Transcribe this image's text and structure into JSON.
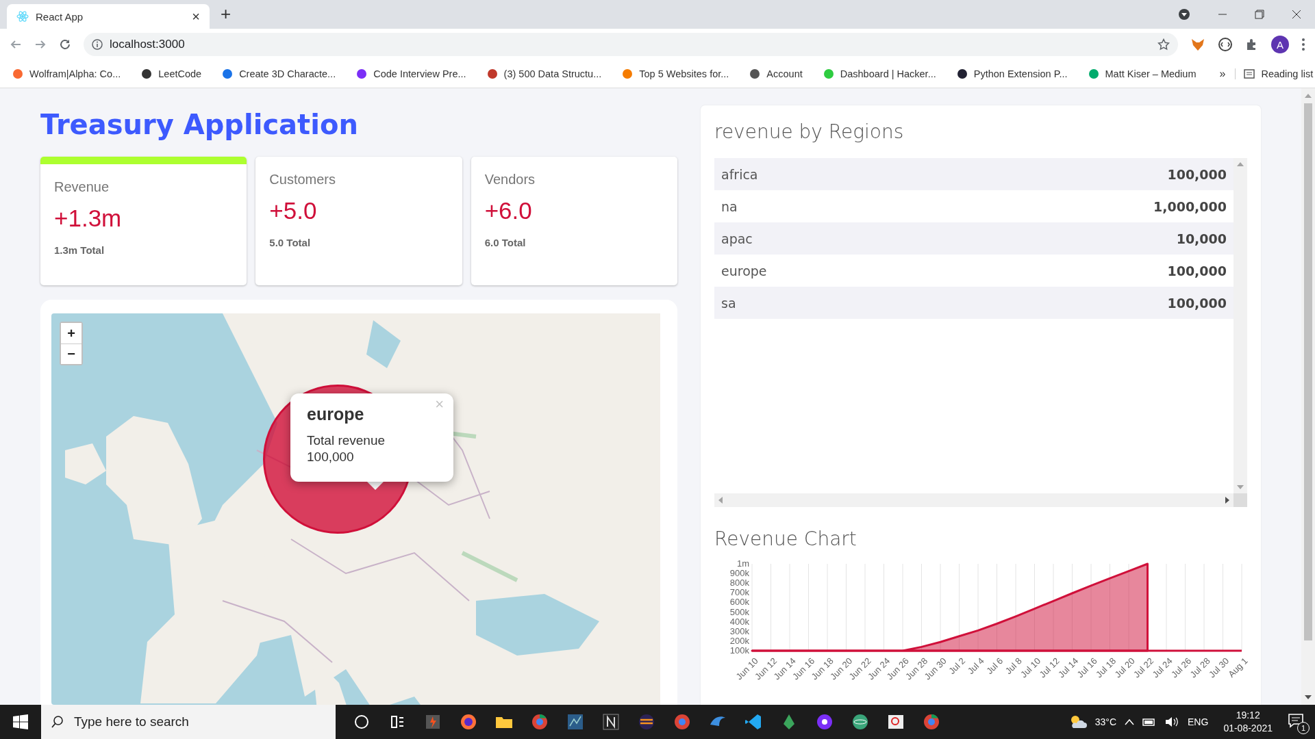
{
  "browser": {
    "tab": {
      "title": "React App",
      "close": "×"
    },
    "new_tab": "+",
    "url": "localhost:3000",
    "profile_initial": "A",
    "bookmarks": [
      {
        "label": "Wolfram|Alpha: Co..."
      },
      {
        "label": "LeetCode"
      },
      {
        "label": "Create 3D Characte..."
      },
      {
        "label": "Code Interview Pre..."
      },
      {
        "label": "(3) 500 Data Structu..."
      },
      {
        "label": "Top 5 Websites for..."
      },
      {
        "label": "Account"
      },
      {
        "label": "Dashboard | Hacker..."
      },
      {
        "label": "Python Extension P..."
      },
      {
        "label": "Matt Kiser – Medium"
      }
    ],
    "more": "»",
    "reading_list": "Reading list"
  },
  "app": {
    "title": "Treasury Application",
    "cards": [
      {
        "label": "Revenue",
        "value": "+1.3m",
        "total": "1.3m Total",
        "selected": true
      },
      {
        "label": "Customers",
        "value": "+5.0",
        "total": "5.0 Total",
        "selected": false
      },
      {
        "label": "Vendors",
        "value": "+6.0",
        "total": "6.0 Total",
        "selected": false
      }
    ]
  },
  "map": {
    "kind": "picture",
    "zoom_in": "+",
    "zoom_out": "−",
    "popup": {
      "title": "europe",
      "text": "Total revenue",
      "value": "100,000",
      "close": "×"
    }
  },
  "regions": {
    "title": "revenue by Regions",
    "rows": [
      {
        "region": "africa",
        "revenue": "100,000"
      },
      {
        "region": "na",
        "revenue": "1,000,000"
      },
      {
        "region": "apac",
        "revenue": "10,000"
      },
      {
        "region": "europe",
        "revenue": "100,000"
      },
      {
        "region": "sa",
        "revenue": "100,000"
      }
    ]
  },
  "chart": {
    "title": "Revenue Chart",
    "chart_data": {
      "type": "area",
      "categories": [
        "Jun 10",
        "Jun 12",
        "Jun 14",
        "Jun 16",
        "Jun 18",
        "Jun 20",
        "Jun 22",
        "Jun 24",
        "Jun 26",
        "Jun 28",
        "Jun 30",
        "Jul 2",
        "Jul 4",
        "Jul 6",
        "Jul 8",
        "Jul 10",
        "Jul 12",
        "Jul 14",
        "Jul 16",
        "Jul 18",
        "Jul 20",
        "Jul 22",
        "Jul 24",
        "Jul 26",
        "Jul 28",
        "Jul 30",
        "Aug 1"
      ],
      "series": [
        {
          "color": "#d0103a",
          "values": [
            100000,
            100000,
            100000,
            100000,
            100000,
            100000,
            100000,
            100000,
            100000,
            140000,
            190000,
            250000,
            310000,
            380000,
            455000,
            535000,
            615000,
            695000,
            775000,
            850000,
            925000,
            1000000,
            null,
            null,
            null,
            null,
            null
          ]
        }
      ],
      "grid": true,
      "ylim": [
        100000,
        1000000
      ],
      "yticks": [
        {
          "value": 100000,
          "label": "100k"
        },
        {
          "value": 200000,
          "label": "200k"
        },
        {
          "value": 300000,
          "label": "300k"
        },
        {
          "value": 400000,
          "label": "400k"
        },
        {
          "value": 500000,
          "label": "500k"
        },
        {
          "value": 600000,
          "label": "600k"
        },
        {
          "value": 700000,
          "label": "700k"
        },
        {
          "value": 800000,
          "label": "800k"
        },
        {
          "value": 900000,
          "label": "900k"
        },
        {
          "value": 1000000,
          "label": "1m"
        }
      ]
    }
  },
  "taskbar": {
    "search_placeholder": "Type here to search",
    "temperature": "33°C",
    "language": "ENG",
    "time": "19:12",
    "date": "01-08-2021",
    "notifications": "1"
  }
}
